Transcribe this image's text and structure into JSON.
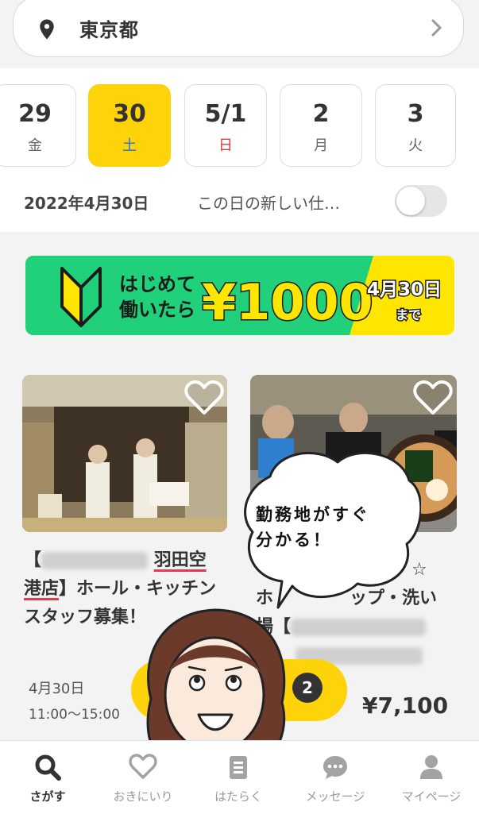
{
  "location": {
    "label": "東京都"
  },
  "dates": [
    {
      "num": "29",
      "weekday": "金"
    },
    {
      "num": "30",
      "weekday": "土",
      "selected": true
    },
    {
      "num": "5/1",
      "weekday": "日"
    },
    {
      "num": "2",
      "weekday": "月"
    },
    {
      "num": "3",
      "weekday": "火"
    }
  ],
  "date_filter": {
    "date": "2022年4月30日",
    "new_jobs_label": "この日の新しい仕…"
  },
  "banner": {
    "line1": "はじめて",
    "line2": "働いたら",
    "amount": "¥1000",
    "deadline_date": "4月30日",
    "deadline_suffix": "まで",
    "bg_color": "#21d07a",
    "accent_color": "#ffe600"
  },
  "jobs": [
    {
      "title_open": "【",
      "title_location": "羽田空港店",
      "title_rest": "】ホール・キッチンスタッフ募集！",
      "date": "4月30日",
      "time": "11:00〜15:00"
    },
    {
      "title_line1": "☆",
      "title_line2": "ホ",
      "title_line2b": "ップ・洗い",
      "title_line3": "場【",
      "price": "¥7,100"
    }
  ],
  "bubble": {
    "line1": "勤務地がすぐ",
    "line2": "分かる！"
  },
  "pill_badge": "2",
  "tabs": [
    {
      "label": "さがす",
      "icon": "search-icon",
      "active": true
    },
    {
      "label": "おきにいり",
      "icon": "heart-icon"
    },
    {
      "label": "はたらく",
      "icon": "clipboard-icon"
    },
    {
      "label": "メッセージ",
      "icon": "chat-icon"
    },
    {
      "label": "マイページ",
      "icon": "user-icon"
    }
  ],
  "colors": {
    "accent": "#ffd30a",
    "sunday": "#e53935",
    "saturday": "#1a73e8"
  }
}
